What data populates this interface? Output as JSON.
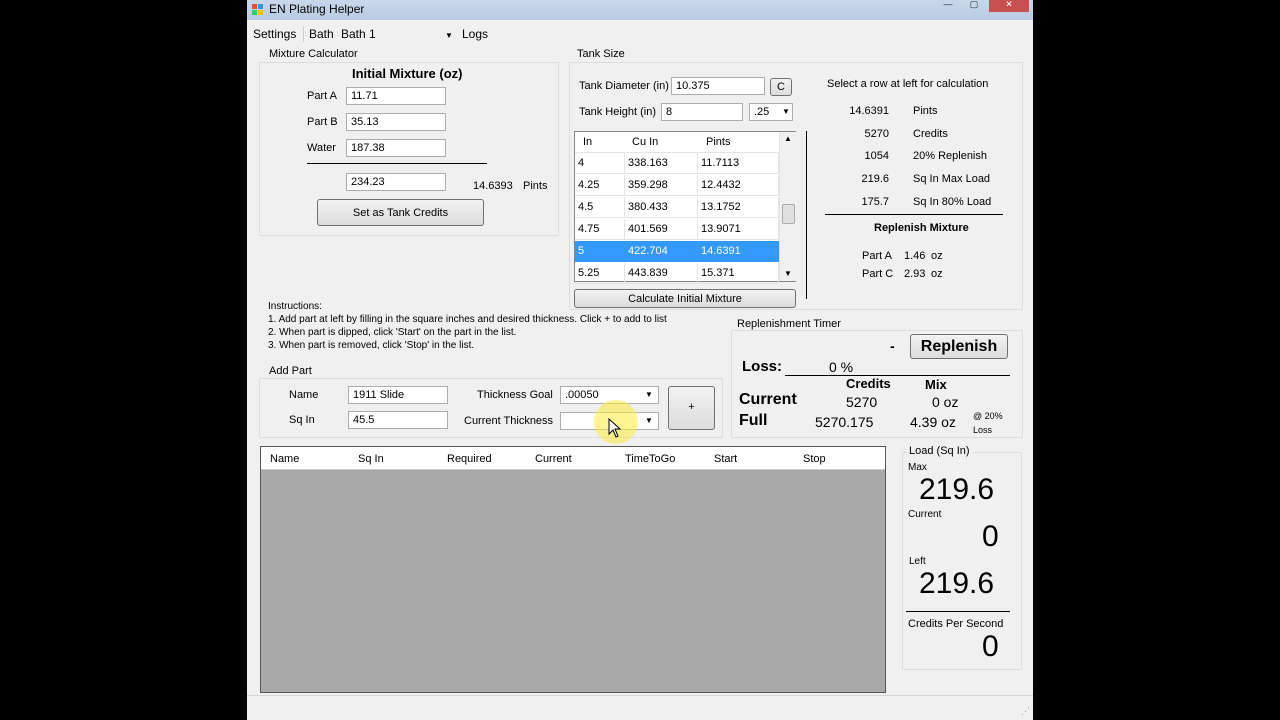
{
  "window": {
    "title": "EN Plating Helper",
    "minimize": "—",
    "maximize": "▢",
    "close": "✕"
  },
  "menu": {
    "settings": "Settings",
    "bath_label": "Bath",
    "bath_value": "Bath 1",
    "logs": "Logs"
  },
  "mixture": {
    "group_title": "Mixture Calculator",
    "heading": "Initial Mixture (oz)",
    "part_a_label": "Part A",
    "part_a": "11.71",
    "part_b_label": "Part B",
    "part_b": "35.13",
    "water_label": "Water",
    "water": "187.38",
    "total": "234.23",
    "pints_value": "14.6393",
    "pints_label": "Pints",
    "set_button": "Set as Tank Credits"
  },
  "tank": {
    "group_title": "Tank Size",
    "diameter_label": "Tank Diameter (in)",
    "diameter": "10.375",
    "c_button": "C",
    "height_label": "Tank Height (in)",
    "height": "8",
    "step": ".25",
    "columns": [
      "In",
      "Cu In",
      "Pints"
    ],
    "rows": [
      [
        "4",
        "338.163",
        "11.7113"
      ],
      [
        "4.25",
        "359.298",
        "12.4432"
      ],
      [
        "4.5",
        "380.433",
        "13.1752"
      ],
      [
        "4.75",
        "401.569",
        "13.9071"
      ],
      [
        "5",
        "422.704",
        "14.6391"
      ],
      [
        "5.25",
        "443.839",
        "15.371"
      ]
    ],
    "calc_button": "Calculate Initial Mixture"
  },
  "calc": {
    "hint": "Select a row at left for calculation",
    "stats": [
      [
        "14.6391",
        "Pints"
      ],
      [
        "5270",
        "Credits"
      ],
      [
        "1054",
        "20% Replenish"
      ],
      [
        "219.6",
        "Sq In Max Load"
      ],
      [
        "175.7",
        "Sq In 80% Load"
      ]
    ],
    "replenish_heading": "Replenish Mixture",
    "part_a_label": "Part A",
    "part_a": "1.46",
    "part_a_unit": "oz",
    "part_c_label": "Part C",
    "part_c": "2.93",
    "part_c_unit": "oz"
  },
  "instructions": {
    "title": "Instructions:",
    "lines": [
      "1. Add part at left by filling in the square inches and desired thickness. Click + to add to list",
      "2. When part is dipped, click 'Start' on the part in the list.",
      "3. When part is removed, click 'Stop' in the list."
    ]
  },
  "add_part": {
    "group_title": "Add Part",
    "name_label": "Name",
    "name": "1911 Slide",
    "sqin_label": "Sq In",
    "sqin": "45.5",
    "goal_label": "Thickness Goal",
    "goal": ".00050",
    "current_label": "Current Thickness",
    "current": "",
    "add_button": "+"
  },
  "timer": {
    "group_title": "Replenishment Timer",
    "dash": "-",
    "replenish_button": "Replenish",
    "loss_label": "Loss:",
    "loss_value": "0 %",
    "credits_header": "Credits",
    "mix_header": "Mix",
    "current_label": "Current",
    "current_credits": "5270",
    "current_mix": "0 oz",
    "full_label": "Full",
    "full_credits": "5270.175",
    "full_mix": "4.39 oz",
    "note_top": "@ 20%",
    "note_bottom": "Loss"
  },
  "parts_list": {
    "columns": [
      "Name",
      "Sq In",
      "Required",
      "Current",
      "TimeToGo",
      "Start",
      "Stop"
    ]
  },
  "load": {
    "group_title": "Load (Sq In)",
    "max_label": "Max",
    "max": "219.6",
    "current_label": "Current",
    "current": "0",
    "left_label": "Left",
    "left": "219.6",
    "cps_label": "Credits Per Second",
    "cps": "0"
  },
  "colors": {
    "selection": "#3399ff",
    "list_bg": "#a9a9a9",
    "titlebar": "#c3d3e8"
  }
}
